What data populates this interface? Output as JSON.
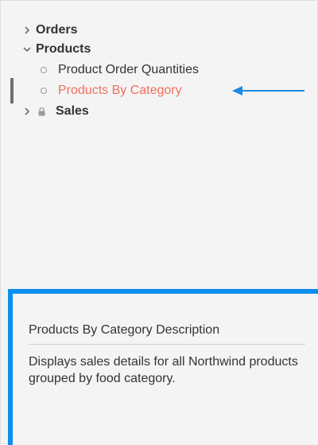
{
  "tree": {
    "orders": {
      "label": "Orders",
      "chevron": "chevron-right-icon"
    },
    "products": {
      "label": "Products",
      "chevron": "chevron-down-icon",
      "children": [
        {
          "label": "Product Order Quantities",
          "selected": false
        },
        {
          "label": "Products By Category",
          "selected": true
        }
      ]
    },
    "sales": {
      "label": "Sales",
      "chevron": "chevron-right-icon",
      "locked": true
    }
  },
  "description": {
    "title": "Products By Category Description",
    "text": "Displays sales details for all Northwind products grouped by food category."
  },
  "colors": {
    "selected_text": "#f26f5b",
    "accent_blue": "#0a8ff0",
    "arrow_blue": "#1e88e5",
    "text": "#333333"
  }
}
